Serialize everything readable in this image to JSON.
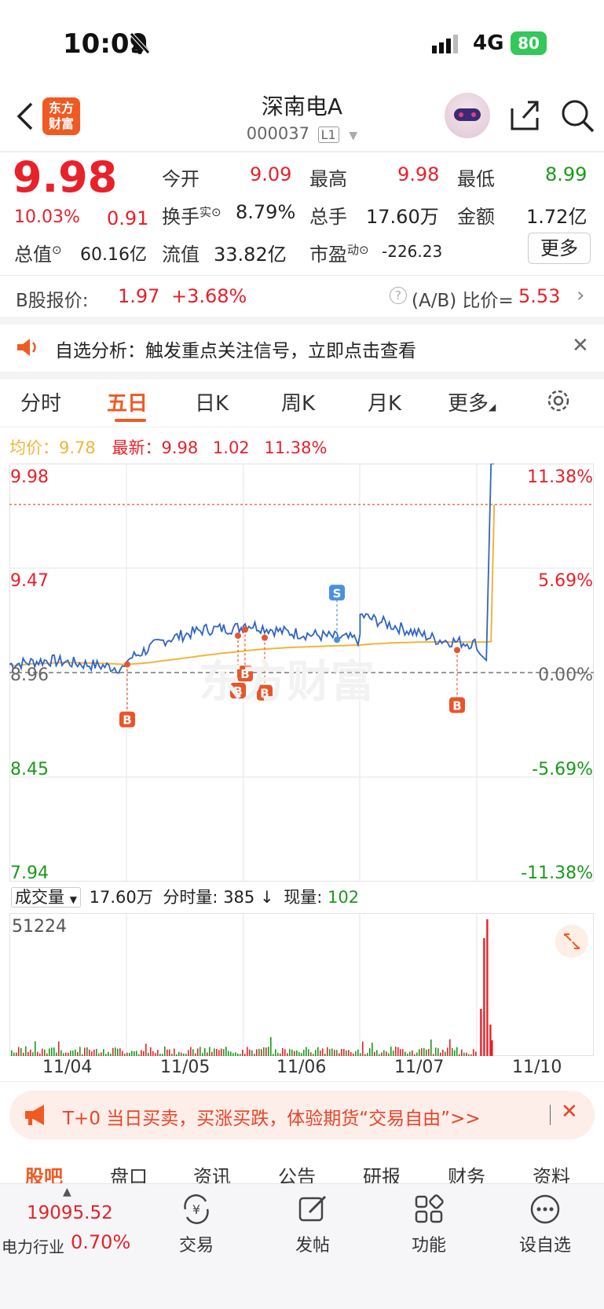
{
  "status": {
    "time": "10:09",
    "network": "4G",
    "battery": "80"
  },
  "header": {
    "logo_text": "东方财富",
    "title": "深南电A",
    "code": "000037",
    "level": "L1"
  },
  "quote": {
    "price": "9.98",
    "change_pct": "10.03%",
    "change_val": "0.91",
    "metrics": [
      {
        "label": "今开",
        "value": "9.09"
      },
      {
        "label": "最高",
        "value": "9.98"
      },
      {
        "label": "最低",
        "value": "8.99"
      },
      {
        "label": "换手",
        "sup": "实",
        "value": "8.79%"
      },
      {
        "label": "总手",
        "value": "17.60万"
      },
      {
        "label": "金额",
        "value": "1.72亿"
      },
      {
        "label": "总值",
        "value": "60.16亿"
      },
      {
        "label": "流值",
        "value": "33.82亿"
      },
      {
        "label": "市盈",
        "sup": "动",
        "value": "-226.23"
      }
    ],
    "more_button": "更多"
  },
  "bshare": {
    "label": "B股报价:",
    "price": "1.97",
    "change": "+3.68%",
    "ratio_label": "(A/B) 比价=",
    "ratio": "5.53"
  },
  "banner": {
    "text": "自选分析：触发重点关注信号，立即点击查看"
  },
  "tabs": [
    "分时",
    "五日",
    "日K",
    "周K",
    "月K",
    "更多"
  ],
  "active_tab": "五日",
  "chart_info": {
    "avg_label": "均价：",
    "avg": "9.78",
    "latest_label": "最新：",
    "latest": "9.98",
    "chg": "1.02",
    "chg_pct": "11.38%"
  },
  "chart_data": {
    "type": "line",
    "x_labels": [
      "11/04",
      "11/05",
      "11/06",
      "11/07",
      "11/10"
    ],
    "y_left": [
      "9.98",
      "9.47",
      "8.96",
      "8.45",
      "7.94"
    ],
    "y_right": [
      "11.38%",
      "5.69%",
      "0.00%",
      "-5.69%",
      "-11.38%"
    ],
    "ylim": [
      7.94,
      9.98
    ],
    "prev_close": 8.96,
    "series": [
      {
        "name": "均价",
        "color": "#f2b43a"
      },
      {
        "name": "最新",
        "color": "#2f64c8"
      }
    ],
    "markers": [
      "B",
      "B",
      "B",
      "B",
      "S",
      "B"
    ],
    "watermark": "东方财富"
  },
  "volume": {
    "selector": "成交量",
    "total": "17.60万",
    "tick_label": "分时量:",
    "tick_val": "385",
    "now_label": "现量:",
    "now_val": "102",
    "max": "51224"
  },
  "promo": {
    "text": "T+0 当日买卖，买涨买跌，体验期货“交易自由”>>"
  },
  "bottom_tabs": [
    "股吧",
    "盘口",
    "资讯",
    "公告",
    "研报",
    "财务",
    "资料"
  ],
  "nav": {
    "index_val": "19095.52",
    "industry": "电力行业",
    "industry_pct": "0.70%",
    "items": [
      "交易",
      "发帖",
      "功能",
      "设自选"
    ]
  },
  "colors": {
    "up": "#e8212a",
    "down": "#1a9a1a",
    "accent": "#f05a22",
    "price_line": "#2f64c8",
    "avg_line": "#f2b43a"
  }
}
